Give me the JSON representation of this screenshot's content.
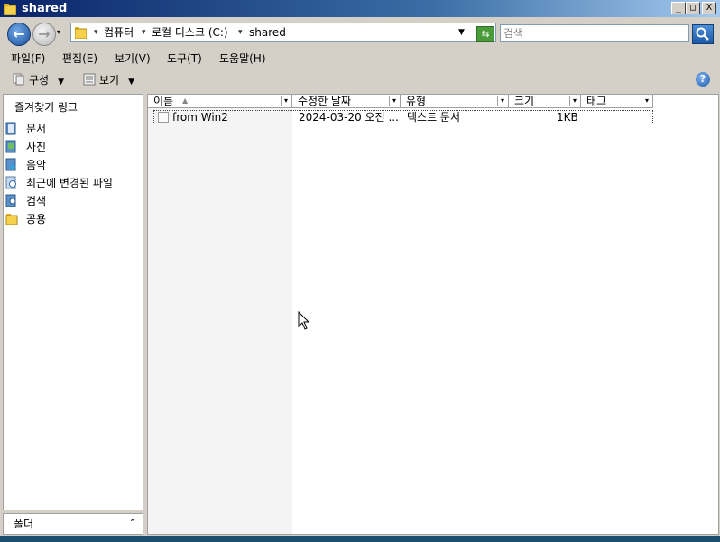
{
  "window": {
    "title": "shared"
  },
  "titlebar_buttons": {
    "minimize": "_",
    "maximize": "□",
    "close": "X"
  },
  "address": {
    "crumbs": [
      "컴퓨터",
      "로컬 디스크 (C:)",
      "shared"
    ],
    "separator": "▾"
  },
  "search": {
    "placeholder": "검색"
  },
  "menu": [
    "파일(F)",
    "편집(E)",
    "보기(V)",
    "도구(T)",
    "도움말(H)"
  ],
  "toolbar": {
    "organize": "구성",
    "views": "보기",
    "help": "?"
  },
  "sidebar": {
    "header": "즐겨찾기 링크",
    "items": [
      {
        "label": "문서",
        "icon": "documents-icon"
      },
      {
        "label": "사진",
        "icon": "pictures-icon"
      },
      {
        "label": "음악",
        "icon": "music-icon"
      },
      {
        "label": "최근에 변경된 파일",
        "icon": "recent-files-icon"
      },
      {
        "label": "검색",
        "icon": "search-folder-icon"
      },
      {
        "label": "공용",
        "icon": "public-folder-icon"
      }
    ],
    "folders_label": "폴더"
  },
  "columns": [
    "이름",
    "수정한 날짜",
    "유형",
    "크기",
    "태그"
  ],
  "files": [
    {
      "name": "from Win2",
      "modified": "2024-03-20 오전 ...",
      "type": "텍스트 문서",
      "size": "1KB",
      "tags": ""
    }
  ],
  "colors": {
    "title_start": "#0a246a",
    "title_end": "#a6caf0",
    "window_bg": "#d4d0c8",
    "sort_column_bg": "#f4f4f4"
  }
}
